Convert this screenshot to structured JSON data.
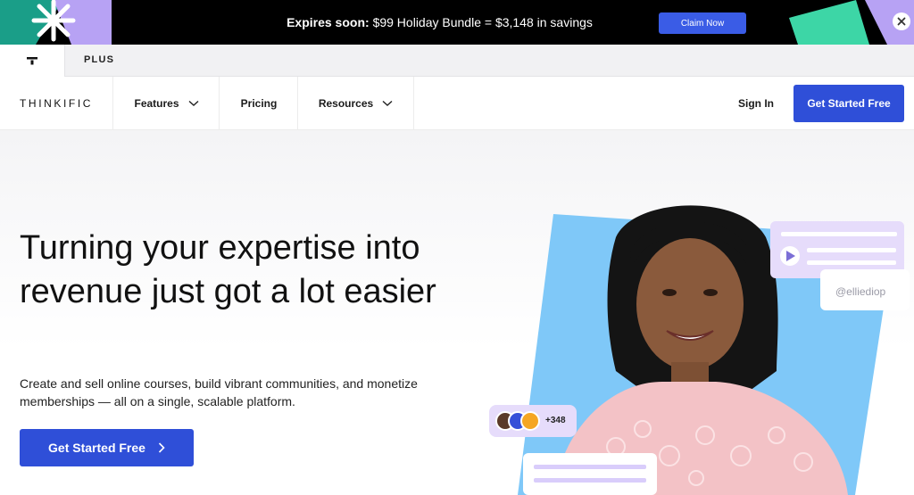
{
  "promo": {
    "expires_label": "Expires soon:",
    "offer_text": "$99 Holiday Bundle = $3,148 in savings",
    "claim_label": "Claim Now"
  },
  "tabs": {
    "plus_label": "PLUS"
  },
  "nav": {
    "logo": "THINKIFIC",
    "features_label": "Features",
    "pricing_label": "Pricing",
    "resources_label": "Resources",
    "signin_label": "Sign In",
    "cta_label": "Get Started Free"
  },
  "hero": {
    "title": "Turning your expertise into revenue just got a lot easier",
    "subtitle": "Create and sell online courses, build vibrant communities, and monetize memberships — all on a single, scalable platform.",
    "cta_label": "Get Started Free",
    "handle": "@elliediop",
    "member_count": "+348"
  },
  "colors": {
    "brand_blue": "#2f4fd8",
    "banner_bg": "#000000",
    "art_blue": "#7fc8f8",
    "art_lavender": "#e6dcfb"
  }
}
